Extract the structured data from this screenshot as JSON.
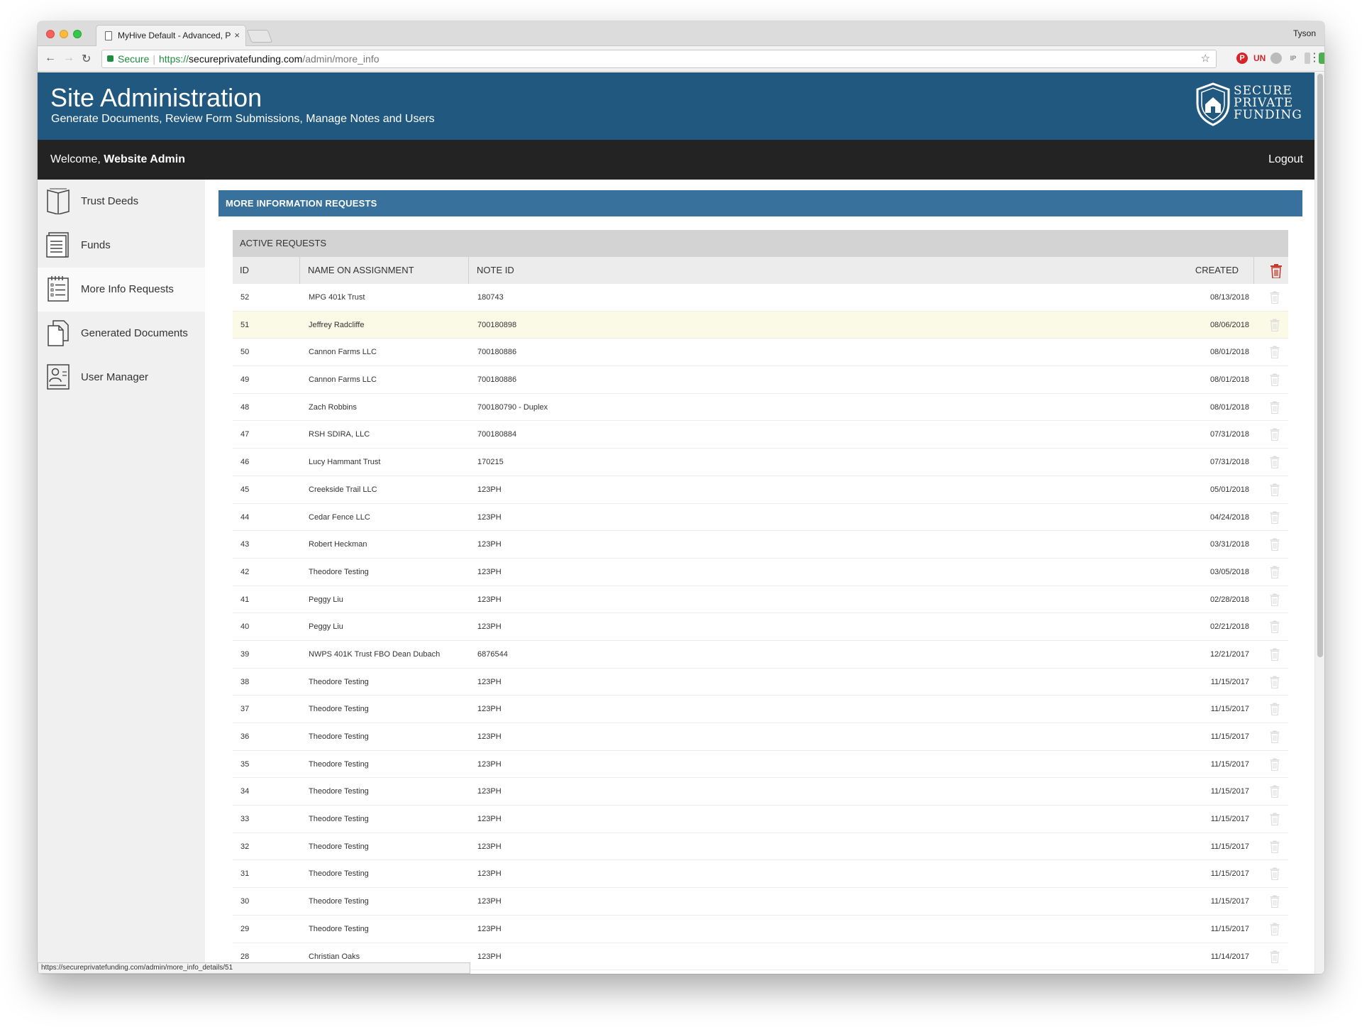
{
  "browser": {
    "tab_title": "MyHive Default - Advanced, P",
    "tab_close": "×",
    "profile": "Tyson",
    "secure_label": "Secure",
    "url_scheme": "https://",
    "url_host": "secureprivatefunding.com",
    "url_path": "/admin/more_info",
    "status_url": "https://secureprivatefunding.com/admin/more_info_details/51"
  },
  "header": {
    "title": "Site Administration",
    "subtitle": "Generate Documents, Review Form Submissions, Manage Notes and Users",
    "logo_line1": "SECURE",
    "logo_line2": "PRIVATE",
    "logo_line3": "FUNDING"
  },
  "welcome_bar": {
    "welcome_prefix": "Welcome,",
    "user_name": "Website Admin",
    "logout_label": "Logout"
  },
  "sidebar": {
    "items": [
      {
        "label": "Trust Deeds",
        "icon": "book-icon"
      },
      {
        "label": "Funds",
        "icon": "ledger-icon"
      },
      {
        "label": "More Info Requests",
        "icon": "checklist-icon"
      },
      {
        "label": "Generated Documents",
        "icon": "documents-icon"
      },
      {
        "label": "User Manager",
        "icon": "user-card-icon"
      }
    ],
    "active_index": 2
  },
  "main": {
    "section_title": "MORE INFORMATION REQUESTS",
    "panel_title": "ACTIVE REQUESTS",
    "columns": {
      "id": "ID",
      "name": "NAME ON ASSIGNMENT",
      "note": "NOTE ID",
      "created": "CREATED"
    },
    "rows": [
      {
        "id": "52",
        "name": "MPG 401k Trust",
        "note": "180743",
        "created": "08/13/2018"
      },
      {
        "id": "51",
        "name": "Jeffrey Radcliffe",
        "note": "700180898",
        "created": "08/06/2018"
      },
      {
        "id": "50",
        "name": "Cannon Farms LLC",
        "note": "700180886",
        "created": "08/01/2018"
      },
      {
        "id": "49",
        "name": "Cannon Farms LLC",
        "note": "700180886",
        "created": "08/01/2018"
      },
      {
        "id": "48",
        "name": "Zach Robbins",
        "note": "700180790 - Duplex",
        "created": "08/01/2018"
      },
      {
        "id": "47",
        "name": "RSH SDIRA, LLC",
        "note": "700180884",
        "created": "07/31/2018"
      },
      {
        "id": "46",
        "name": "Lucy Hammant Trust",
        "note": "170215",
        "created": "07/31/2018"
      },
      {
        "id": "45",
        "name": "Creekside Trail LLC",
        "note": "123PH",
        "created": "05/01/2018"
      },
      {
        "id": "44",
        "name": "Cedar Fence LLC",
        "note": "123PH",
        "created": "04/24/2018"
      },
      {
        "id": "43",
        "name": "Robert Heckman",
        "note": "123PH",
        "created": "03/31/2018"
      },
      {
        "id": "42",
        "name": "Theodore Testing",
        "note": "123PH",
        "created": "03/05/2018"
      },
      {
        "id": "41",
        "name": "Peggy Liu",
        "note": "123PH",
        "created": "02/28/2018"
      },
      {
        "id": "40",
        "name": "Peggy Liu",
        "note": "123PH",
        "created": "02/21/2018"
      },
      {
        "id": "39",
        "name": "NWPS 401K Trust FBO Dean Dubach",
        "note": "6876544",
        "created": "12/21/2017"
      },
      {
        "id": "38",
        "name": "Theodore Testing",
        "note": "123PH",
        "created": "11/15/2017"
      },
      {
        "id": "37",
        "name": "Theodore Testing",
        "note": "123PH",
        "created": "11/15/2017"
      },
      {
        "id": "36",
        "name": "Theodore Testing",
        "note": "123PH",
        "created": "11/15/2017"
      },
      {
        "id": "35",
        "name": "Theodore Testing",
        "note": "123PH",
        "created": "11/15/2017"
      },
      {
        "id": "34",
        "name": "Theodore Testing",
        "note": "123PH",
        "created": "11/15/2017"
      },
      {
        "id": "33",
        "name": "Theodore Testing",
        "note": "123PH",
        "created": "11/15/2017"
      },
      {
        "id": "32",
        "name": "Theodore Testing",
        "note": "123PH",
        "created": "11/15/2017"
      },
      {
        "id": "31",
        "name": "Theodore Testing",
        "note": "123PH",
        "created": "11/15/2017"
      },
      {
        "id": "30",
        "name": "Theodore Testing",
        "note": "123PH",
        "created": "11/15/2017"
      },
      {
        "id": "29",
        "name": "Theodore Testing",
        "note": "123PH",
        "created": "11/15/2017"
      },
      {
        "id": "28",
        "name": "Christian Oaks",
        "note": "123PH",
        "created": "11/14/2017"
      }
    ],
    "highlighted_row_index": 1
  },
  "colors": {
    "header_bg": "#21587f",
    "section_bg": "#38719b",
    "welcome_bg": "#232323",
    "delete_red": "#c0392b",
    "highlight_row": "#fafae6"
  }
}
